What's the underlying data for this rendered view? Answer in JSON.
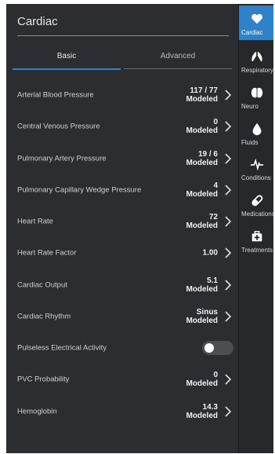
{
  "header": {
    "title": "Cardiac"
  },
  "tabs": {
    "basic": "Basic",
    "advanced": "Advanced"
  },
  "rows": [
    {
      "label": "Arterial Blood Pressure",
      "value": "117 / 77",
      "sub": "Modeled"
    },
    {
      "label": "Central Venous Pressure",
      "value": "0",
      "sub": "Modeled"
    },
    {
      "label": "Pulmonary Artery Pressure",
      "value": "19 / 6",
      "sub": "Modeled"
    },
    {
      "label": "Pulmonary Capillary Wedge Pressure",
      "value": "4",
      "sub": "Modeled"
    },
    {
      "label": "Heart Rate",
      "value": "72",
      "sub": "Modeled"
    },
    {
      "label": "Heart Rate Factor",
      "value": "1.00",
      "sub": ""
    },
    {
      "label": "Cardiac Output",
      "value": "5.1",
      "sub": "Modeled"
    },
    {
      "label": "Cardiac Rhythm",
      "value": "Sinus",
      "sub": "Modeled"
    },
    {
      "label": "Pulseless Electrical Activity",
      "toggle": false
    },
    {
      "label": "PVC Probability",
      "value": "0",
      "sub": "Modeled"
    },
    {
      "label": "Hemoglobin",
      "value": "14.3",
      "sub": "Modeled"
    }
  ],
  "sidebar": [
    {
      "label": "Cardiac",
      "icon": "heart-icon",
      "active": true
    },
    {
      "label": "Respiratory",
      "icon": "lungs-icon",
      "active": false
    },
    {
      "label": "Neuro",
      "icon": "brain-icon",
      "active": false
    },
    {
      "label": "Fluids",
      "icon": "drop-icon",
      "active": false
    },
    {
      "label": "Conditions",
      "icon": "pulse-icon",
      "active": false
    },
    {
      "label": "Medications",
      "icon": "pill-icon",
      "active": false
    },
    {
      "label": "Treatments",
      "icon": "medkit-icon",
      "active": false
    }
  ],
  "colors": {
    "accent": "#2f82c8",
    "panel": "#2c2d30",
    "sidebar": "#27282b"
  }
}
